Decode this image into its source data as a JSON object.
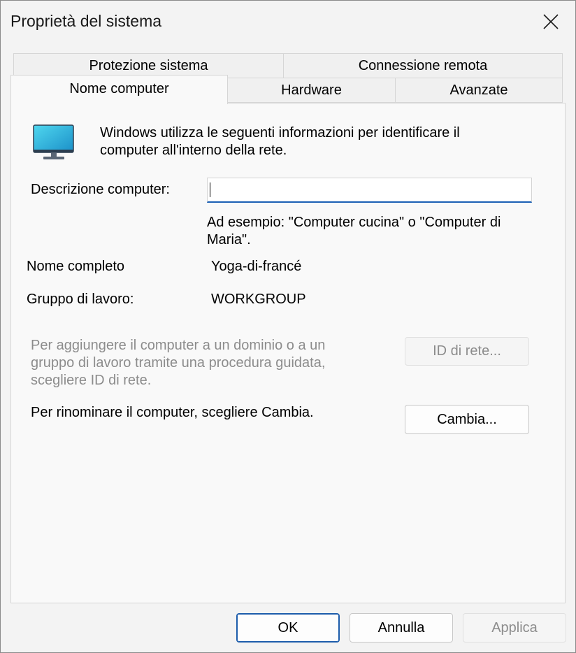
{
  "window": {
    "title": "Proprietà del sistema"
  },
  "tabs": {
    "row1": [
      "Protezione sistema",
      "Connessione remota"
    ],
    "row2": [
      "Nome computer",
      "Hardware",
      "Avanzate"
    ],
    "active": "Nome computer"
  },
  "intro": {
    "text_line1": "Windows utilizza le seguenti informazioni per identificare il",
    "text_line2": "computer all'interno della rete."
  },
  "description": {
    "label": "Descrizione computer:",
    "value": "",
    "hint_line1": "Ad esempio: \"Computer cucina\" o \"Computer di",
    "hint_line2": "Maria\"."
  },
  "full_name": {
    "label": "Nome completo",
    "value": "Yoga-di-francé"
  },
  "workgroup": {
    "label": "Gruppo di lavoro:",
    "value": "WORKGROUP"
  },
  "domain_info": {
    "line1": "Per aggiungere il computer a un dominio o a un",
    "line2": "gruppo di lavoro tramite una procedura guidata,",
    "line3": "scegliere ID di rete.",
    "button": "ID di rete..."
  },
  "rename_info": {
    "text": "Per rinominare il computer, scegliere Cambia.",
    "button": "Cambia..."
  },
  "footer": {
    "ok": "OK",
    "cancel": "Annulla",
    "apply": "Applica"
  },
  "colors": {
    "accent": "#1a5fb4",
    "disabled_text": "#8c8c8c"
  },
  "icons": {
    "computer": "monitor-icon",
    "close": "close-icon"
  }
}
